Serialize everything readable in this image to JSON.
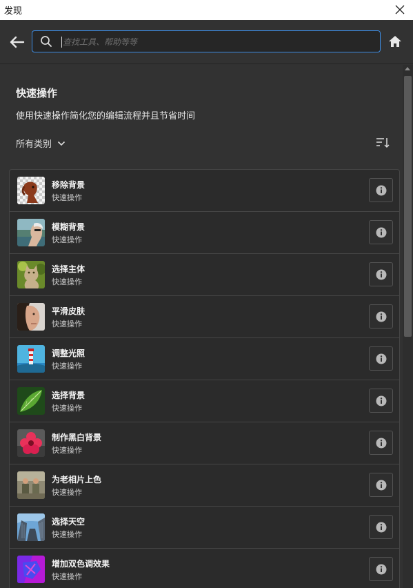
{
  "window": {
    "title": "发现"
  },
  "search": {
    "placeholder": "查找工具、帮助等等"
  },
  "section": {
    "title": "快速操作",
    "description": "使用快速操作简化您的编辑流程并且节省时间"
  },
  "filter": {
    "category_label": "所有类别"
  },
  "icons": {
    "close": "close-icon",
    "back": "arrow-left-icon",
    "search": "search-icon",
    "home": "home-icon",
    "sort": "sort-icon",
    "info": "info-icon",
    "chevron": "chevron-down-icon"
  },
  "colors": {
    "accent": "#3d8ee6",
    "background": "#323232",
    "list_bg": "#2b2b2b"
  },
  "actions": [
    {
      "name": "移除背景",
      "type": "快速操作",
      "thumb": "dog"
    },
    {
      "name": "模糊背景",
      "type": "快速操作",
      "thumb": "man"
    },
    {
      "name": "选择主体",
      "type": "快速操作",
      "thumb": "cat"
    },
    {
      "name": "平滑皮肤",
      "type": "快速操作",
      "thumb": "face"
    },
    {
      "name": "调整光照",
      "type": "快速操作",
      "thumb": "lighthouse"
    },
    {
      "name": "选择背景",
      "type": "快速操作",
      "thumb": "leaf"
    },
    {
      "name": "制作黑白背景",
      "type": "快速操作",
      "thumb": "flower"
    },
    {
      "name": "为老相片上色",
      "type": "快速操作",
      "thumb": "old-photo"
    },
    {
      "name": "选择天空",
      "type": "快速操作",
      "thumb": "sky"
    },
    {
      "name": "增加双色调效果",
      "type": "快速操作",
      "thumb": "duotone"
    }
  ]
}
